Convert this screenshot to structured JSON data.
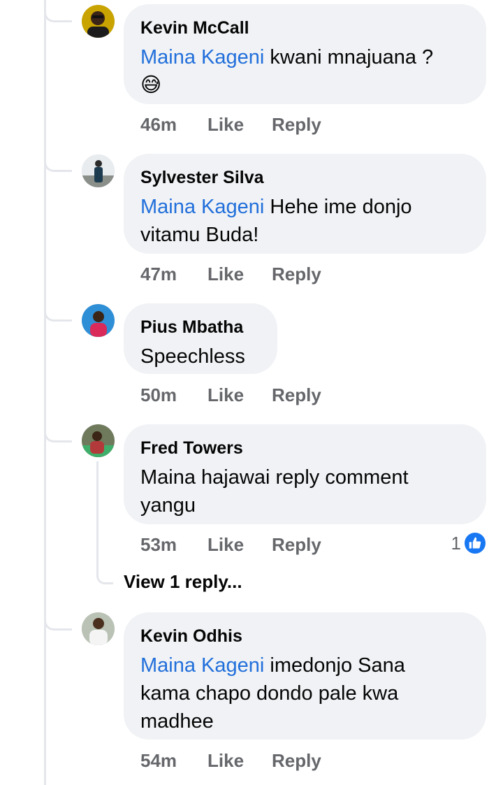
{
  "comments": [
    {
      "author": "Kevin  McCall",
      "mention": "Maina Kageni",
      "text_line1": " kwani mnajuana ?",
      "text_line2": "😅",
      "time": "46m",
      "like_label": "Like",
      "reply_label": "Reply"
    },
    {
      "author": "Sylvester Silva",
      "mention": "Maina Kageni",
      "text_line1": " Hehe ime donjo",
      "text_line2": "vitamu Buda!",
      "time": "47m",
      "like_label": "Like",
      "reply_label": "Reply"
    },
    {
      "author": "Pius Mbatha",
      "text_line1": "Speechless",
      "time": "50m",
      "like_label": "Like",
      "reply_label": "Reply"
    },
    {
      "author": "Fred Towers",
      "text_line1": "Maina hajawai reply comment",
      "text_line2": "yangu",
      "time": "53m",
      "like_label": "Like",
      "reply_label": "Reply",
      "reaction_count": "1",
      "view_replies": "View 1 reply..."
    },
    {
      "author": "Kevin Odhis",
      "mention": "Maina Kageni",
      "text_line1": " imedonjo Sana",
      "text_line2": "kama chapo dondo pale kwa",
      "text_line3": "madhee",
      "time": "54m",
      "like_label": "Like",
      "reply_label": "Reply"
    }
  ],
  "colors": {
    "bubble": "#f0f2f5",
    "mention": "#216fdb",
    "meta": "#65676b",
    "like_badge": "#1877f2"
  }
}
